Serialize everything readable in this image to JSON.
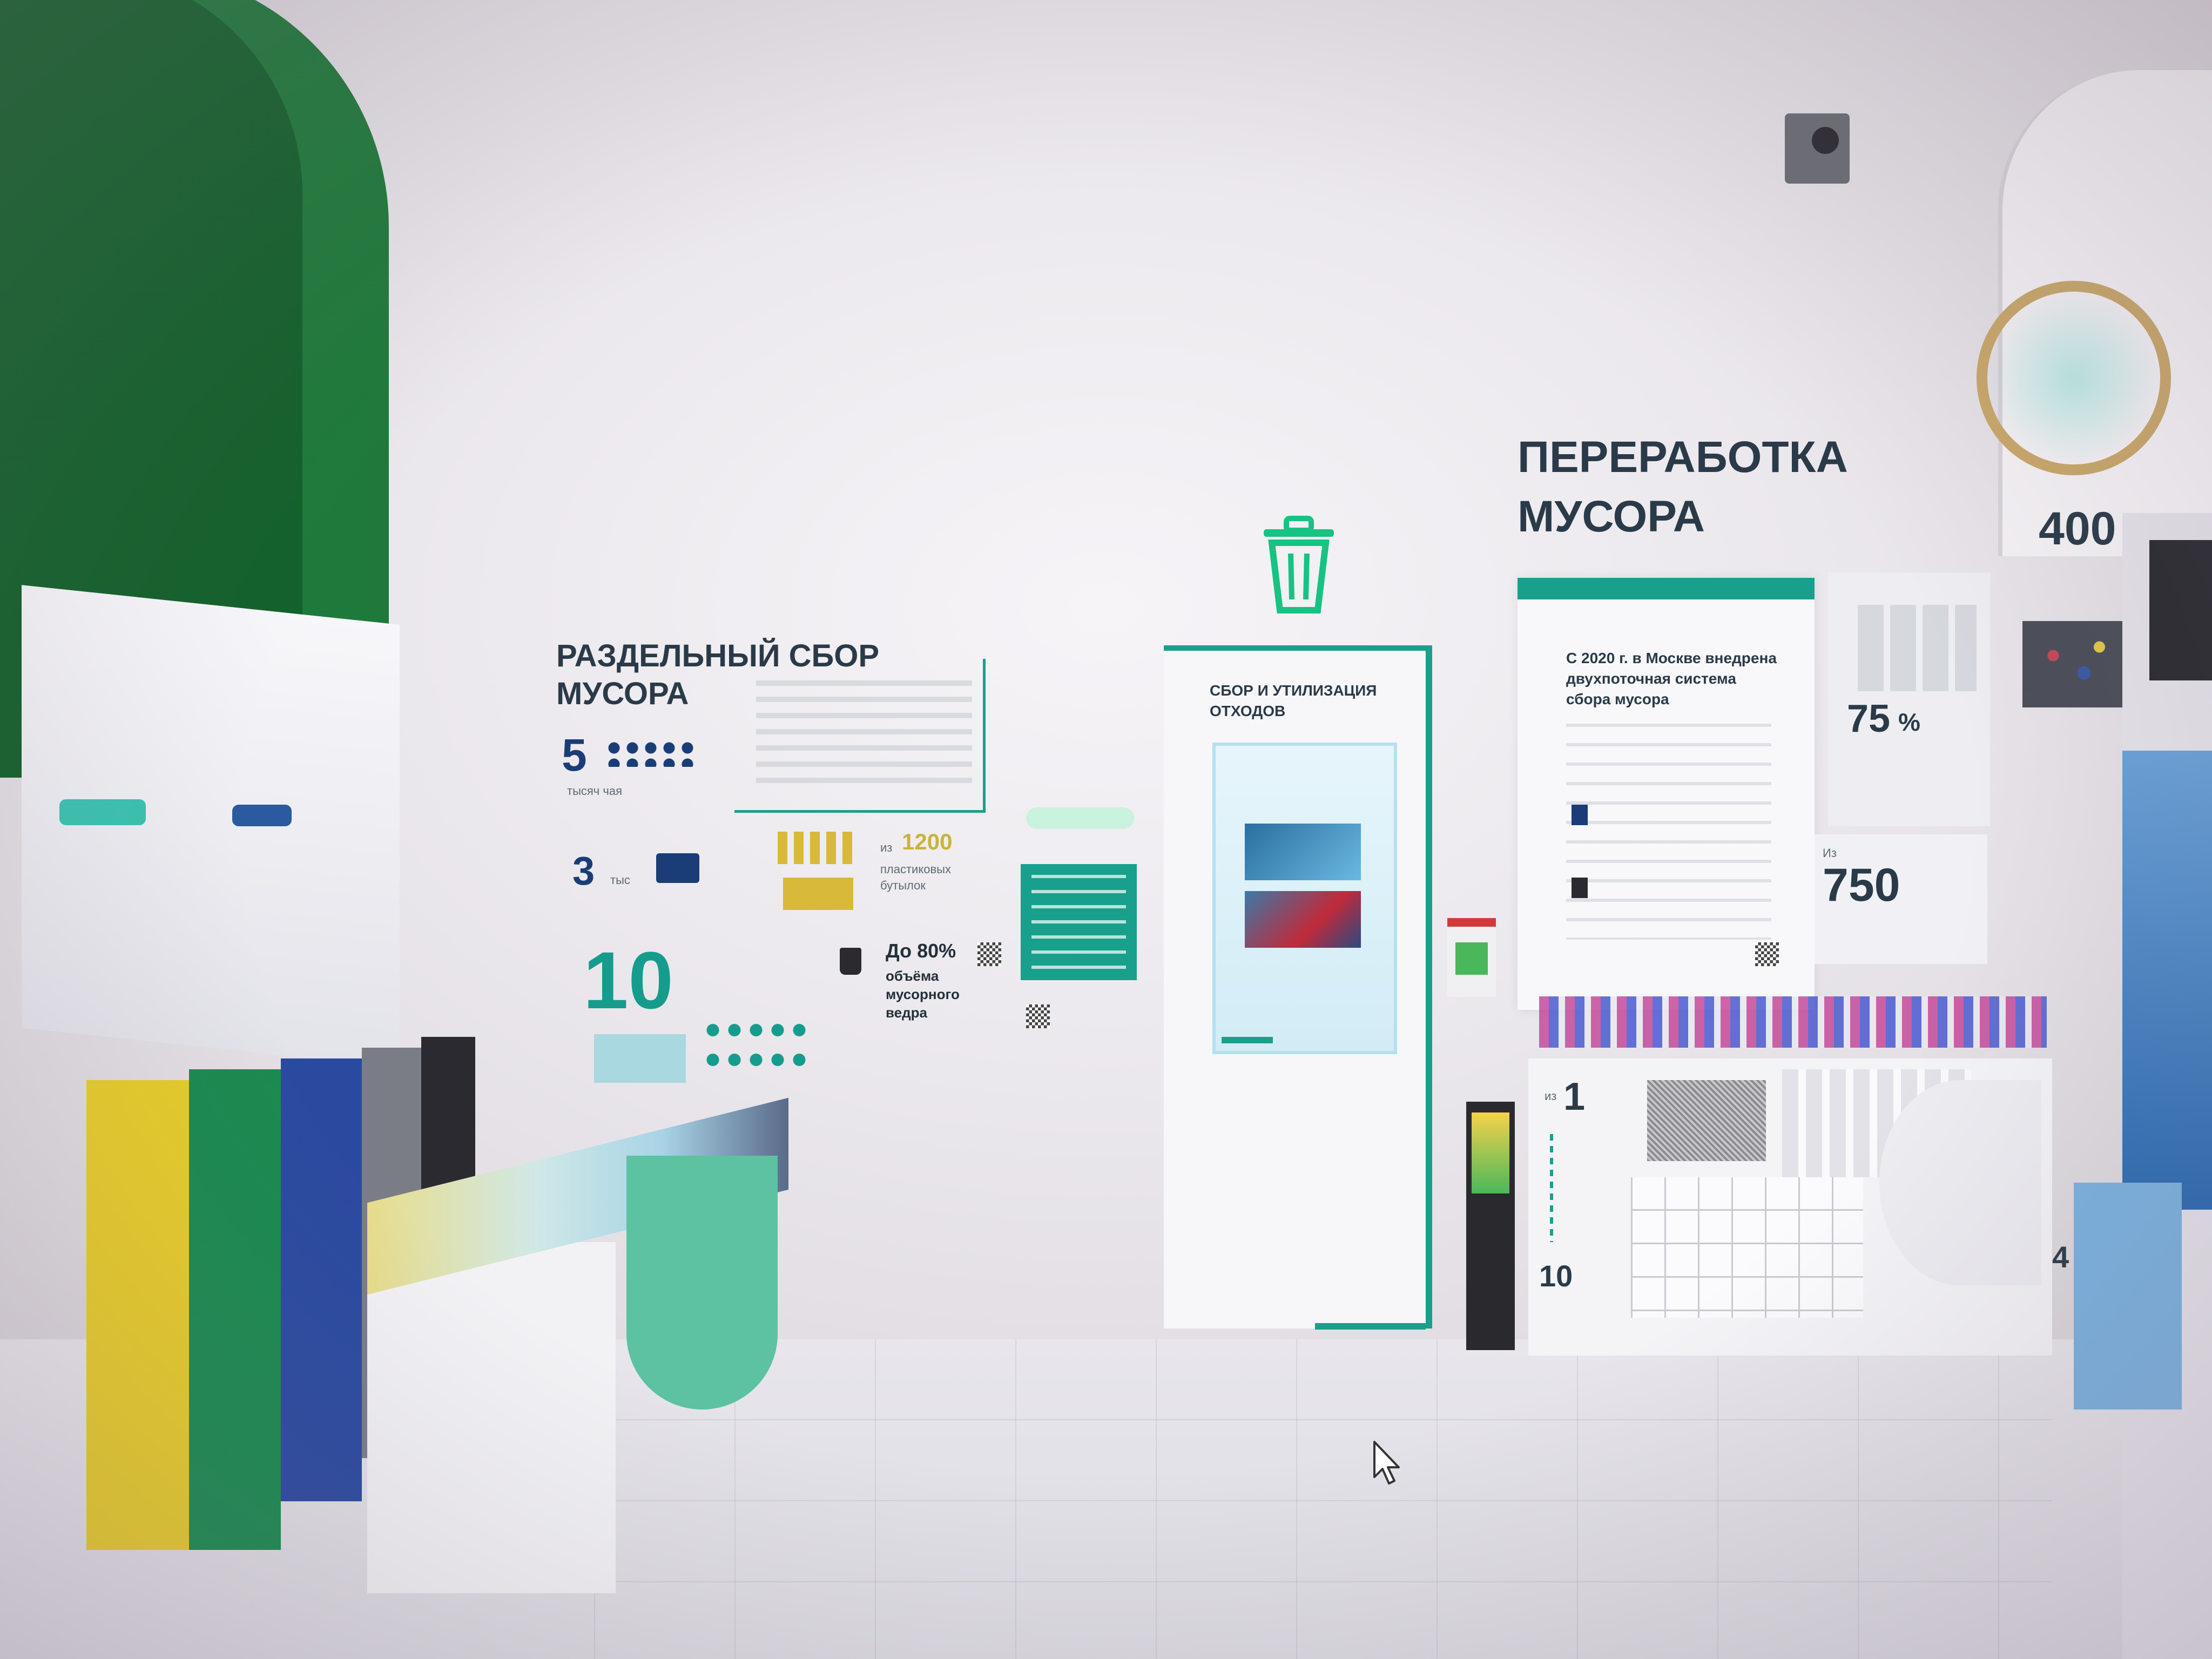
{
  "left_panel": {
    "title": "РАЗДЕЛЬНЫЙ СБОР МУСОРА",
    "stat_5": "5",
    "stat_5_caption": "тысяч чая",
    "stat_3": "3",
    "stat_3_caption": "тыс",
    "stat_10": "10",
    "stat_1200": "1200",
    "stat_1200_prefix": "из",
    "stat_1200_caption": "пластиковых бутылок",
    "stat_80": "До 80%",
    "stat_80_caption": "объёма мусорного ведра"
  },
  "middle_panel": {
    "title": "СБОР И УТИЛИЗАЦИЯ ОТХОДОВ"
  },
  "right_panel": {
    "title_line1": "ПЕРЕРАБОТКА",
    "title_line2": "МУСОРА",
    "card_text": "С 2020 г. в Москве внедрена двухпоточная система сбора мусора",
    "stat_75": "75",
    "stat_75_unit": "%",
    "stat_750": "750",
    "stat_750_prefix": "Из",
    "stat_400": "400",
    "stat_1": "1",
    "stat_1_prefix": "из",
    "stat_10": "10",
    "stat_4": "4"
  },
  "colors": {
    "accent_green": "#1e7a3a",
    "teal": "#18a08c",
    "navy": "#1a3d77",
    "yellow": "#e6cc2a",
    "bin_green": "#1a8a50",
    "bin_blue": "#2a4aa0",
    "bin_gray": "#7a7d86",
    "bin_black": "#2a2a30"
  },
  "icons": [
    "trash-icon",
    "qr-code-icon",
    "mouse-cursor-icon",
    "bicycle-wheel-icon"
  ]
}
